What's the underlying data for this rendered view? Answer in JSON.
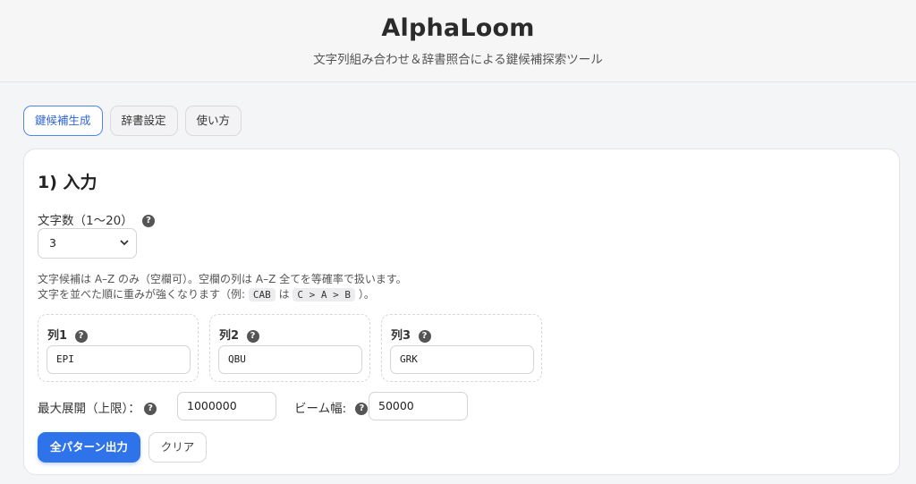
{
  "header": {
    "title": "AlphaLoom",
    "subtitle": "文字列組み合わせ＆辞書照合による鍵候補探索ツール"
  },
  "tabs": [
    {
      "label": "鍵候補生成",
      "active": true
    },
    {
      "label": "辞書設定",
      "active": false
    },
    {
      "label": "使い方",
      "active": false
    }
  ],
  "input_section": {
    "title": "1) 入力",
    "char_count_label": "文字数（1〜20）",
    "char_count_value": "3",
    "help_icon_glyph": "?",
    "note_line1": "文字候補は A–Z のみ（空欄可）。空欄の列は A–Z 全てを等確率で扱います。",
    "note_line2_prefix": "文字を並べた順に重みが強くなります（例:",
    "note_code_example": "CAB",
    "note_line2_mid": "は",
    "note_code_order": "C > A > B",
    "note_line2_suffix": "）。",
    "columns": [
      {
        "label": "列1",
        "value": "EPI"
      },
      {
        "label": "列2",
        "value": "QBU"
      },
      {
        "label": "列3",
        "value": "GRK"
      }
    ],
    "max_expansion_label": "最大展開（上限）：",
    "max_expansion_value": "1000000",
    "beam_width_label": "ビーム幅:",
    "beam_width_value": "50000",
    "output_all_button": "全パターン出力",
    "clear_button": "クリア"
  },
  "colors": {
    "accent": "#2f73ea",
    "active_tab_border": "#4d86f0"
  },
  "icons": [
    "help-icon",
    "chevron-down-icon"
  ]
}
